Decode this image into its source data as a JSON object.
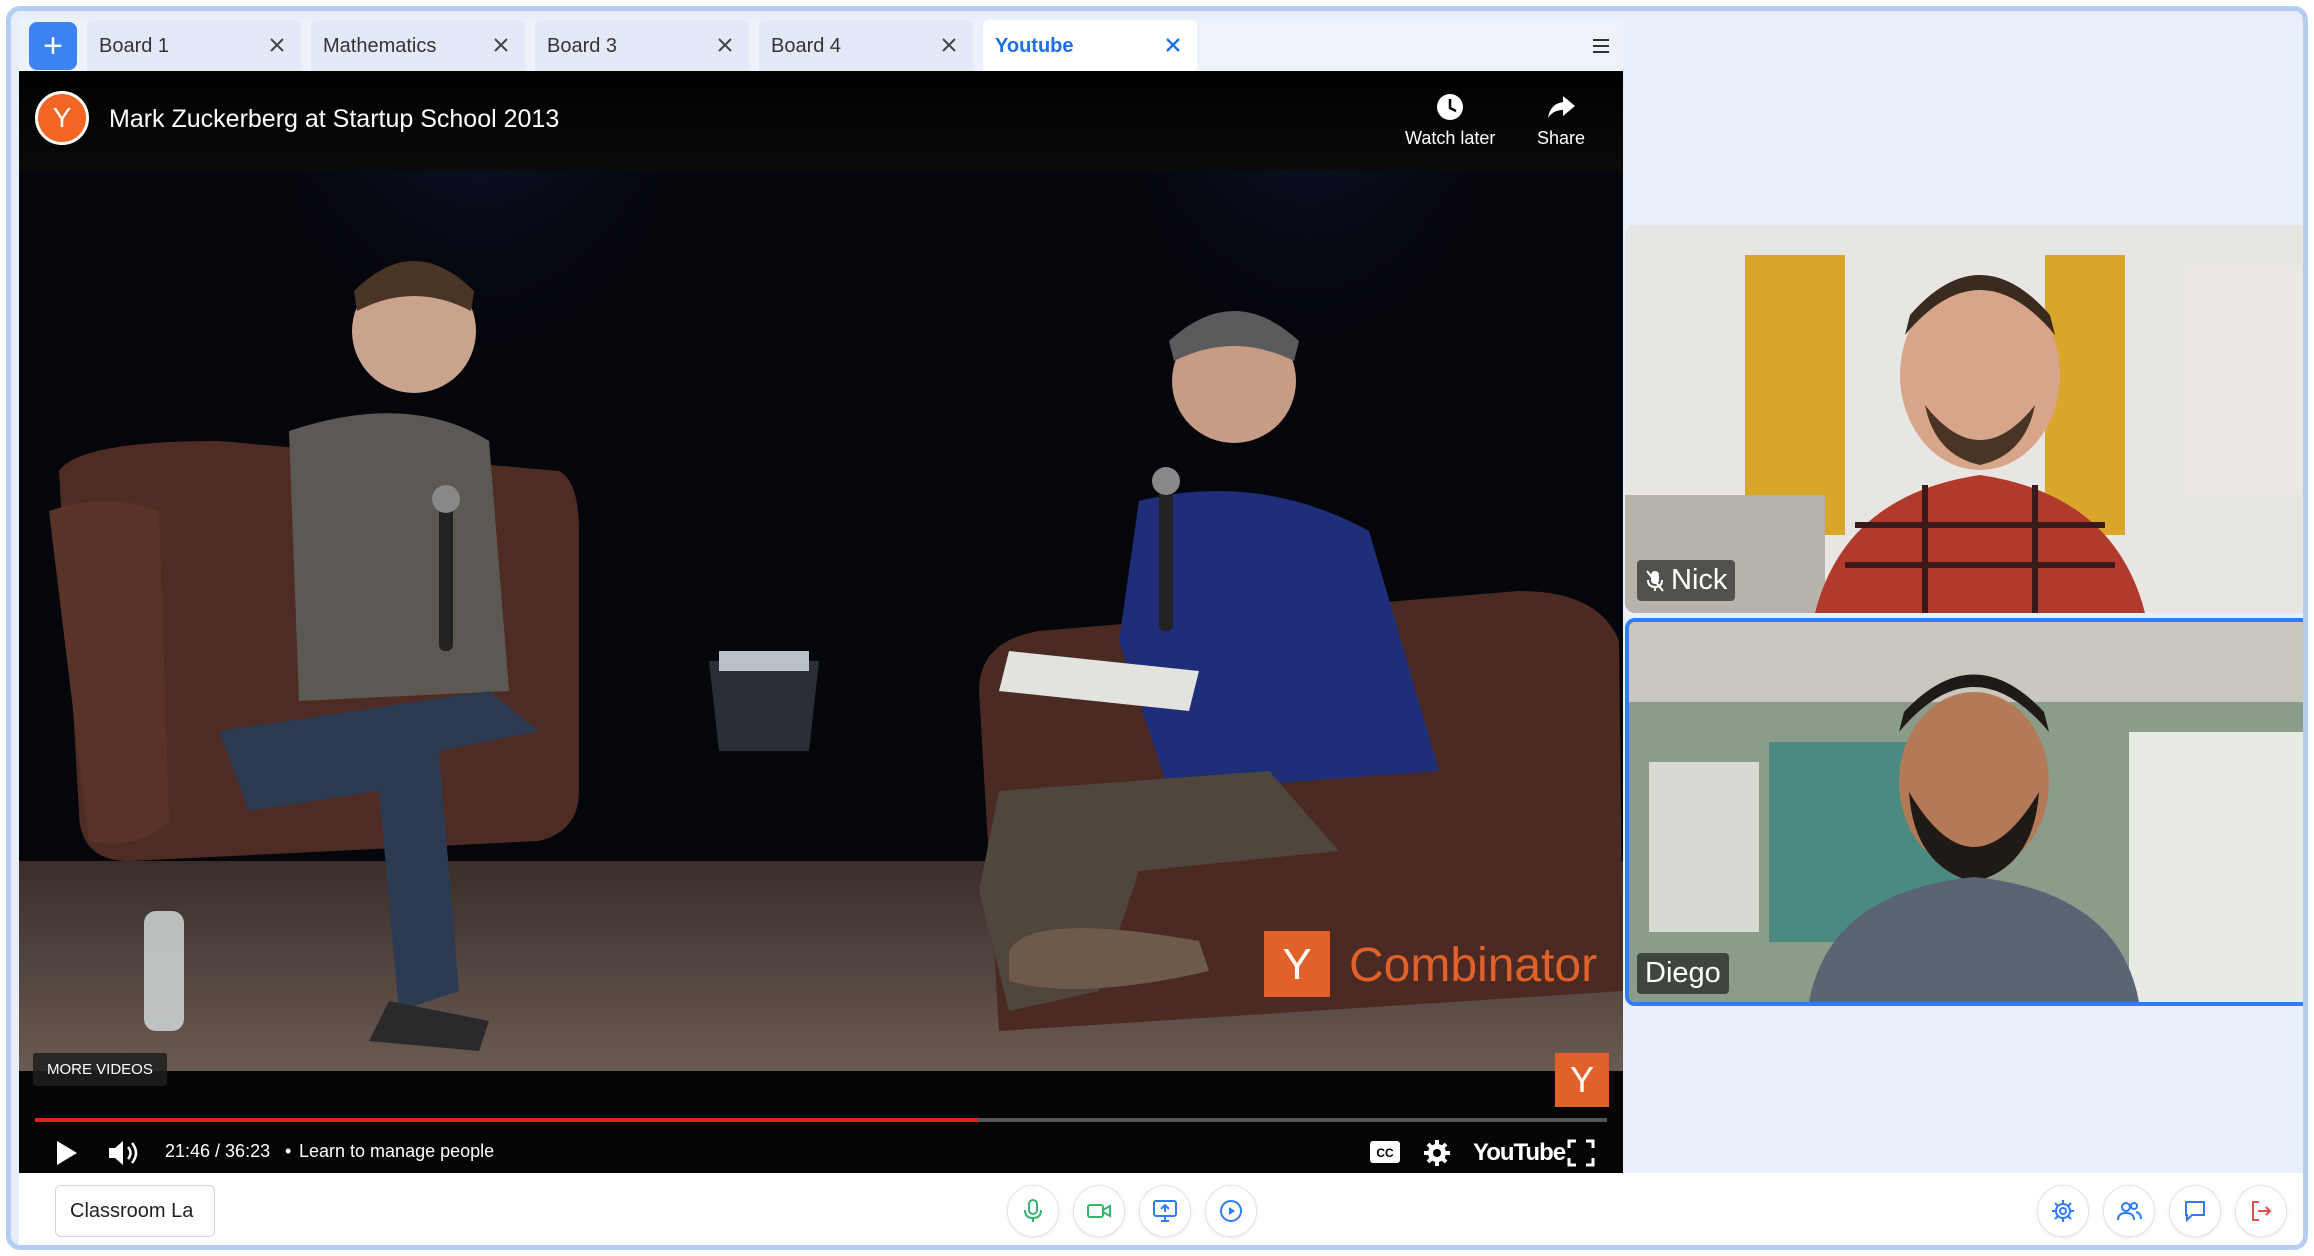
{
  "tabs": [
    {
      "label": "Board 1",
      "active": false
    },
    {
      "label": "Mathematics",
      "active": false
    },
    {
      "label": "Board 3",
      "active": false
    },
    {
      "label": "Board 4",
      "active": false
    },
    {
      "label": "Youtube",
      "active": true
    }
  ],
  "video": {
    "title": "Mark Zuckerberg at Startup School 2013",
    "channel_letter": "Y",
    "watch_later": "Watch later",
    "share": "Share",
    "more_videos": "MORE VIDEOS",
    "watermark": "Combinator",
    "watermark_letter": "Y",
    "time": "21:46 / 36:23",
    "chapter": "Learn to manage people",
    "brand": "YouTube",
    "progress": 0.6
  },
  "participants": [
    {
      "name": "Nick",
      "muted": true
    },
    {
      "name": "Diego",
      "muted": false
    }
  ],
  "classroom_field": "Classroom La",
  "colors": {
    "accent": "#3c82f0",
    "frame": "#b7ccf1",
    "youtube_red": "#e5231b",
    "yc_orange": "#e0622a",
    "leave_red": "#e05252"
  }
}
